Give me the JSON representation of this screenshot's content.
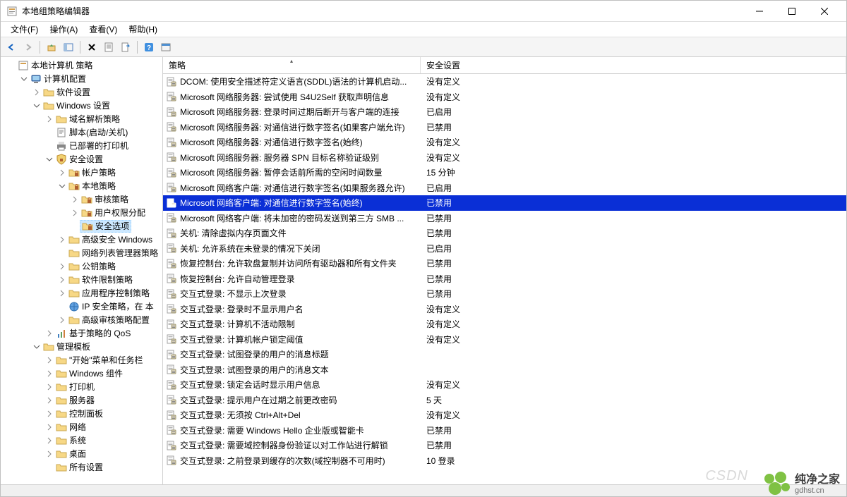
{
  "window": {
    "title": "本地组策略编辑器"
  },
  "menubar": [
    {
      "label": "文件(F)"
    },
    {
      "label": "操作(A)"
    },
    {
      "label": "查看(V)"
    },
    {
      "label": "帮助(H)"
    }
  ],
  "tree": [
    {
      "depth": 0,
      "toggle": "",
      "icon": "console",
      "label": "本地计算机 策略"
    },
    {
      "depth": 1,
      "toggle": "open",
      "icon": "computer",
      "label": "计算机配置"
    },
    {
      "depth": 2,
      "toggle": "closed",
      "icon": "folder",
      "label": "软件设置"
    },
    {
      "depth": 2,
      "toggle": "open",
      "icon": "folder",
      "label": "Windows 设置"
    },
    {
      "depth": 3,
      "toggle": "closed",
      "icon": "folder",
      "label": "域名解析策略"
    },
    {
      "depth": 3,
      "toggle": "",
      "icon": "script",
      "label": "脚本(启动/关机)"
    },
    {
      "depth": 3,
      "toggle": "",
      "icon": "printer",
      "label": "已部署的打印机"
    },
    {
      "depth": 3,
      "toggle": "open",
      "icon": "security",
      "label": "安全设置"
    },
    {
      "depth": 4,
      "toggle": "closed",
      "icon": "folder-lock",
      "label": "帐户策略"
    },
    {
      "depth": 4,
      "toggle": "open",
      "icon": "folder-lock",
      "label": "本地策略"
    },
    {
      "depth": 5,
      "toggle": "closed",
      "icon": "folder-lock",
      "label": "审核策略"
    },
    {
      "depth": 5,
      "toggle": "closed",
      "icon": "folder-lock",
      "label": "用户权限分配"
    },
    {
      "depth": 5,
      "toggle": "",
      "icon": "folder-lock",
      "label": "安全选项",
      "selected": true
    },
    {
      "depth": 4,
      "toggle": "closed",
      "icon": "folder",
      "label": "高级安全 Windows"
    },
    {
      "depth": 4,
      "toggle": "",
      "icon": "folder",
      "label": "网络列表管理器策略"
    },
    {
      "depth": 4,
      "toggle": "closed",
      "icon": "folder",
      "label": "公钥策略"
    },
    {
      "depth": 4,
      "toggle": "closed",
      "icon": "folder",
      "label": "软件限制策略"
    },
    {
      "depth": 4,
      "toggle": "closed",
      "icon": "folder",
      "label": "应用程序控制策略"
    },
    {
      "depth": 4,
      "toggle": "",
      "icon": "ipsec",
      "label": "IP 安全策略，在 本"
    },
    {
      "depth": 4,
      "toggle": "closed",
      "icon": "folder",
      "label": "高级审核策略配置"
    },
    {
      "depth": 3,
      "toggle": "closed",
      "icon": "qos",
      "label": "基于策略的 QoS"
    },
    {
      "depth": 2,
      "toggle": "open",
      "icon": "folder",
      "label": "管理模板"
    },
    {
      "depth": 3,
      "toggle": "closed",
      "icon": "folder",
      "label": "\"开始\"菜单和任务栏"
    },
    {
      "depth": 3,
      "toggle": "closed",
      "icon": "folder",
      "label": "Windows 组件"
    },
    {
      "depth": 3,
      "toggle": "closed",
      "icon": "folder",
      "label": "打印机"
    },
    {
      "depth": 3,
      "toggle": "closed",
      "icon": "folder",
      "label": "服务器"
    },
    {
      "depth": 3,
      "toggle": "closed",
      "icon": "folder",
      "label": "控制面板"
    },
    {
      "depth": 3,
      "toggle": "closed",
      "icon": "folder",
      "label": "网络"
    },
    {
      "depth": 3,
      "toggle": "closed",
      "icon": "folder",
      "label": "系统"
    },
    {
      "depth": 3,
      "toggle": "closed",
      "icon": "folder",
      "label": "桌面"
    },
    {
      "depth": 3,
      "toggle": "",
      "icon": "folder",
      "label": "所有设置"
    }
  ],
  "list": {
    "columns": {
      "policy": "策略",
      "security": "安全设置"
    },
    "rows": [
      {
        "policy": "DCOM: 使用安全描述符定义语言(SDDL)语法的计算机启动...",
        "security": "没有定义"
      },
      {
        "policy": "Microsoft 网络服务器: 尝试使用 S4U2Self 获取声明信息",
        "security": "没有定义"
      },
      {
        "policy": "Microsoft 网络服务器: 登录时间过期后断开与客户端的连接",
        "security": "已启用"
      },
      {
        "policy": "Microsoft 网络服务器: 对通信进行数字签名(如果客户端允许)",
        "security": "已禁用"
      },
      {
        "policy": "Microsoft 网络服务器: 对通信进行数字签名(始终)",
        "security": "没有定义"
      },
      {
        "policy": "Microsoft 网络服务器: 服务器 SPN 目标名称验证级别",
        "security": "没有定义"
      },
      {
        "policy": "Microsoft 网络服务器: 暂停会话前所需的空闲时间数量",
        "security": "15 分钟"
      },
      {
        "policy": "Microsoft 网络客户端: 对通信进行数字签名(如果服务器允许)",
        "security": "已启用"
      },
      {
        "policy": "Microsoft 网络客户端: 对通信进行数字签名(始终)",
        "security": "已禁用",
        "selected": true
      },
      {
        "policy": "Microsoft 网络客户端: 将未加密的密码发送到第三方 SMB ...",
        "security": "已禁用"
      },
      {
        "policy": "关机: 清除虚拟内存页面文件",
        "security": "已禁用"
      },
      {
        "policy": "关机: 允许系统在未登录的情况下关闭",
        "security": "已启用"
      },
      {
        "policy": "恢复控制台: 允许软盘复制并访问所有驱动器和所有文件夹",
        "security": "已禁用"
      },
      {
        "policy": "恢复控制台: 允许自动管理登录",
        "security": "已禁用"
      },
      {
        "policy": "交互式登录: 不显示上次登录",
        "security": "已禁用"
      },
      {
        "policy": "交互式登录: 登录时不显示用户名",
        "security": "没有定义"
      },
      {
        "policy": "交互式登录: 计算机不活动限制",
        "security": "没有定义"
      },
      {
        "policy": "交互式登录: 计算机帐户锁定阈值",
        "security": "没有定义"
      },
      {
        "policy": "交互式登录: 试图登录的用户的消息标题",
        "security": ""
      },
      {
        "policy": "交互式登录: 试图登录的用户的消息文本",
        "security": ""
      },
      {
        "policy": "交互式登录: 锁定会话时显示用户信息",
        "security": "没有定义"
      },
      {
        "policy": "交互式登录: 提示用户在过期之前更改密码",
        "security": "5 天"
      },
      {
        "policy": "交互式登录: 无须按 Ctrl+Alt+Del",
        "security": "没有定义"
      },
      {
        "policy": "交互式登录: 需要 Windows Hello 企业版或智能卡",
        "security": "已禁用"
      },
      {
        "policy": "交互式登录: 需要域控制器身份验证以对工作站进行解锁",
        "security": "已禁用"
      },
      {
        "policy": "交互式登录: 之前登录到缓存的次数(域控制器不可用时)",
        "security": "10 登录"
      }
    ]
  },
  "watermark": {
    "brand": "纯净之家",
    "url": "gdhst.cn",
    "csdn": "CSDN"
  }
}
